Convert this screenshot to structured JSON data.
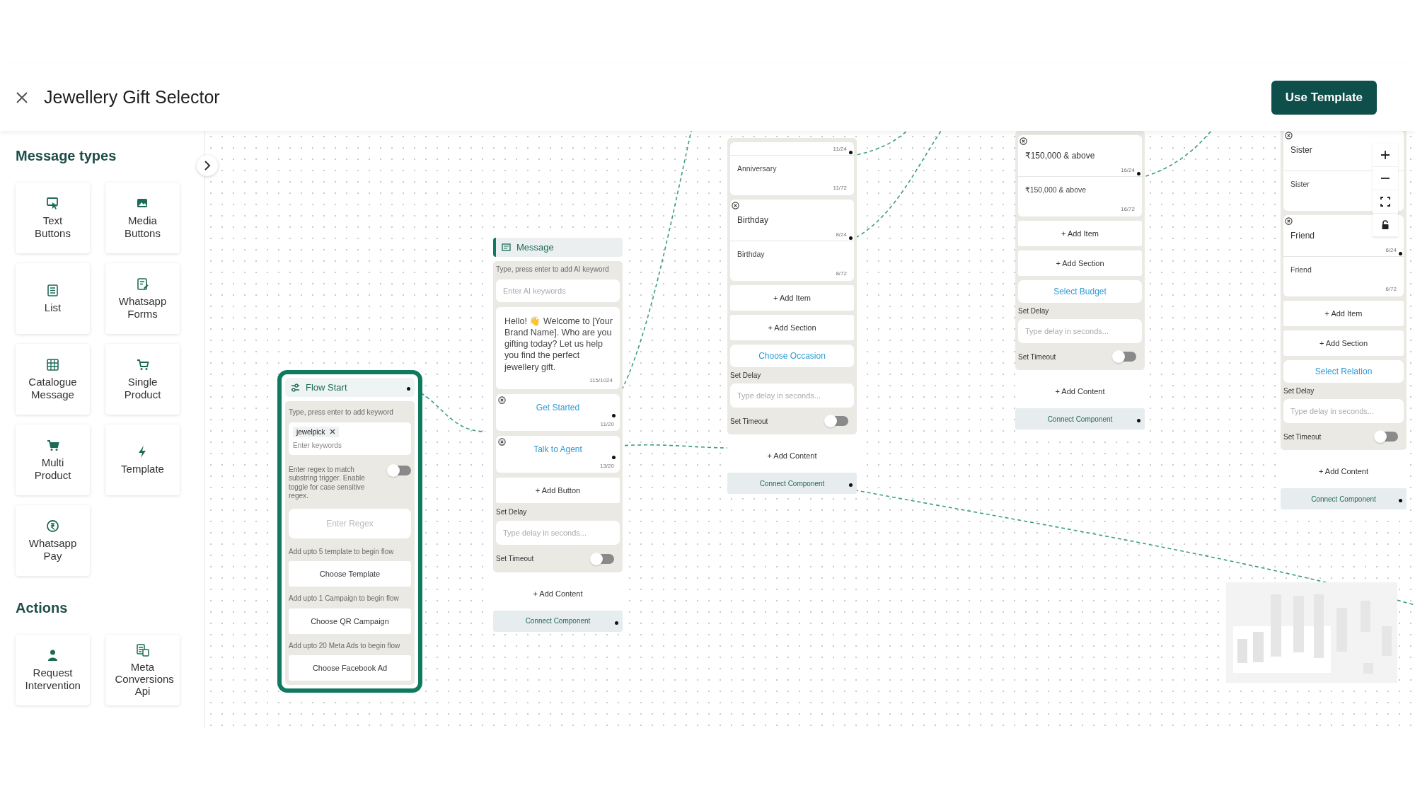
{
  "header": {
    "title": "Jewellery Gift Selector",
    "action": "Use Template"
  },
  "sidebar": {
    "sections": [
      {
        "title": "Message types",
        "items": [
          {
            "label": "Text Buttons"
          },
          {
            "label": "Media Buttons"
          },
          {
            "label": "List"
          },
          {
            "label": "Whatsapp Forms"
          },
          {
            "label": "Catalogue Message"
          },
          {
            "label": "Single Product"
          },
          {
            "label": "Multi Product"
          },
          {
            "label": "Template"
          },
          {
            "label": "Whatsapp Pay"
          }
        ]
      },
      {
        "title": "Actions",
        "items": [
          {
            "label": "Request Intervention"
          },
          {
            "label": "Meta Conversions Api"
          }
        ]
      }
    ]
  },
  "flow_start": {
    "title": "Flow Start",
    "keyword_hint": "Type, press enter to add keyword",
    "tags": [
      "jewelpick"
    ],
    "keyword_placeholder": "Enter keywords",
    "regex_note": "Enter regex to match substring trigger. Enable toggle for case sensitive regex.",
    "regex_case_sensitive": false,
    "regex_placeholder": "Enter Regex",
    "triggers": [
      {
        "hint": "Add upto 5 template to begin flow",
        "button": "Choose Template"
      },
      {
        "hint": "Add upto 1 Campaign to begin flow",
        "button": "Choose QR Campaign"
      },
      {
        "hint": "Add upto 20 Meta Ads to begin flow",
        "button": "Choose Facebook Ad"
      }
    ]
  },
  "message_node": {
    "title": "Message",
    "ai_hint": "Type, press enter to add AI keyword",
    "ai_placeholder": "Enter AI keywords",
    "text": "Hello! 👋 Welcome to [Your Brand Name]. Who are you gifting today? Let us help you find the perfect jewellery gift.",
    "text_count": "115/1024",
    "buttons": [
      {
        "label": "Get Started",
        "count": "11/20"
      },
      {
        "label": "Talk to Agent",
        "count": "13/20"
      }
    ],
    "add_button": "+ Add Button",
    "delay_label": "Set Delay",
    "delay_placeholder": "Type delay in seconds...",
    "timeout_label": "Set Timeout",
    "timeout_on": false,
    "add_content": "+ Add Content",
    "connect": "Connect Component"
  },
  "list_nodes": [
    {
      "sections": [
        {
          "title_count": "11/24",
          "description": "Anniversary",
          "description_count": "11/72"
        },
        {
          "title": "Birthday",
          "title_count": "8/24",
          "description": "Birthday",
          "description_count": "8/72"
        }
      ],
      "add_item": "+ Add Item",
      "add_section": "+ Add Section",
      "list_button": "Choose Occasion",
      "delay_label": "Set Delay",
      "delay_placeholder": "Type delay in seconds...",
      "timeout_label": "Set Timeout",
      "timeout_on": false,
      "add_content": "+ Add Content",
      "connect": "Connect Component"
    },
    {
      "sections": [
        {
          "title": "₹150,000 & above",
          "title_count": "16/24",
          "description": "₹150,000 & above",
          "description_count": "16/72"
        }
      ],
      "add_item": "+ Add Item",
      "add_section": "+ Add Section",
      "list_button": "Select Budget",
      "delay_label": "Set Delay",
      "delay_placeholder": "Type delay in seconds...",
      "timeout_label": "Set Timeout",
      "timeout_on": false,
      "add_content": "+ Add Content",
      "connect": "Connect Component"
    },
    {
      "sections": [
        {
          "title": "Sister",
          "description": "Sister"
        },
        {
          "title": "Friend",
          "title_count": "6/24",
          "description": "Friend",
          "description_count": "6/72"
        }
      ],
      "add_item": "+ Add Item",
      "add_section": "+ Add Section",
      "list_button": "Select Relation",
      "delay_label": "Set Delay",
      "delay_placeholder": "Type delay in seconds...",
      "timeout_label": "Set Timeout",
      "timeout_on": false,
      "add_content": "+ Add Content",
      "connect": "Connect Component"
    }
  ]
}
